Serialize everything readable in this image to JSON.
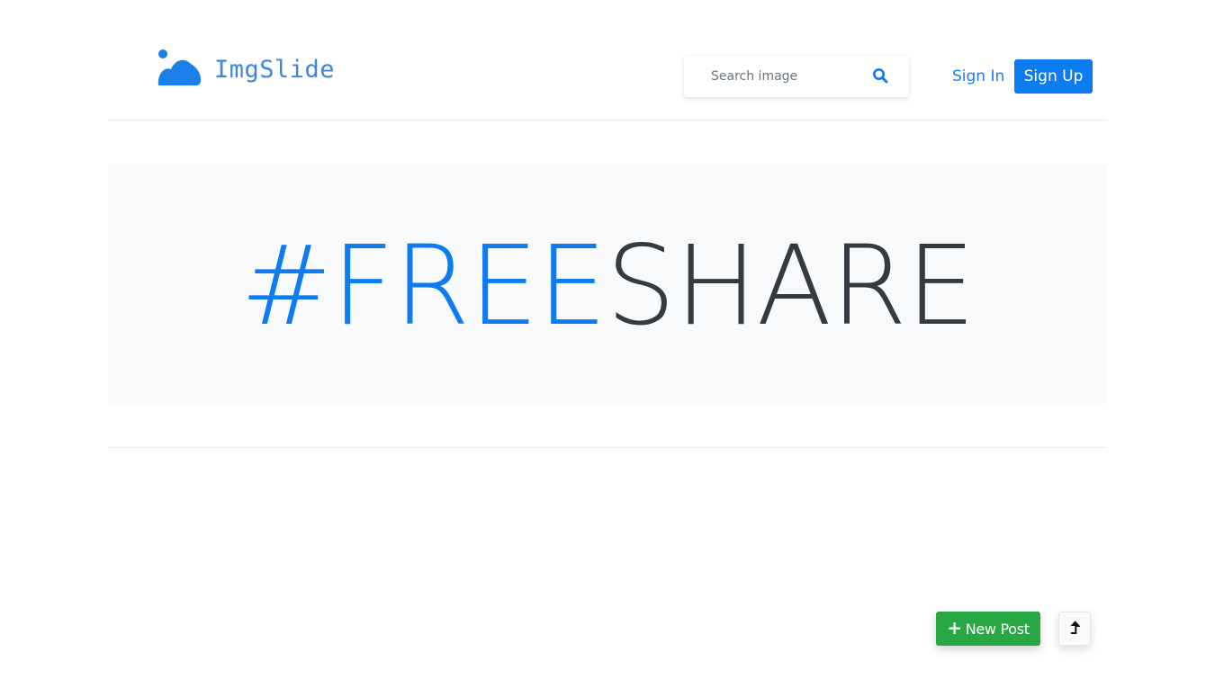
{
  "header": {
    "brand_name": "ImgSlide",
    "logo_icon": "mountains-image-icon",
    "search": {
      "placeholder": "Search image",
      "value": "",
      "icon": "search-icon"
    },
    "signin_label": "Sign In",
    "signup_label": "Sign Up"
  },
  "hero": {
    "accent_text": "#FREE",
    "rest_text": "SHARE"
  },
  "actions": {
    "new_post_label": "New Post",
    "new_post_icon": "plus-icon",
    "scroll_top_icon": "arrow-up-icon"
  },
  "colors": {
    "primary": "#0d7cf2",
    "success": "#28a745",
    "dark": "#343a40",
    "hero_bg": "#f8f9fa"
  }
}
